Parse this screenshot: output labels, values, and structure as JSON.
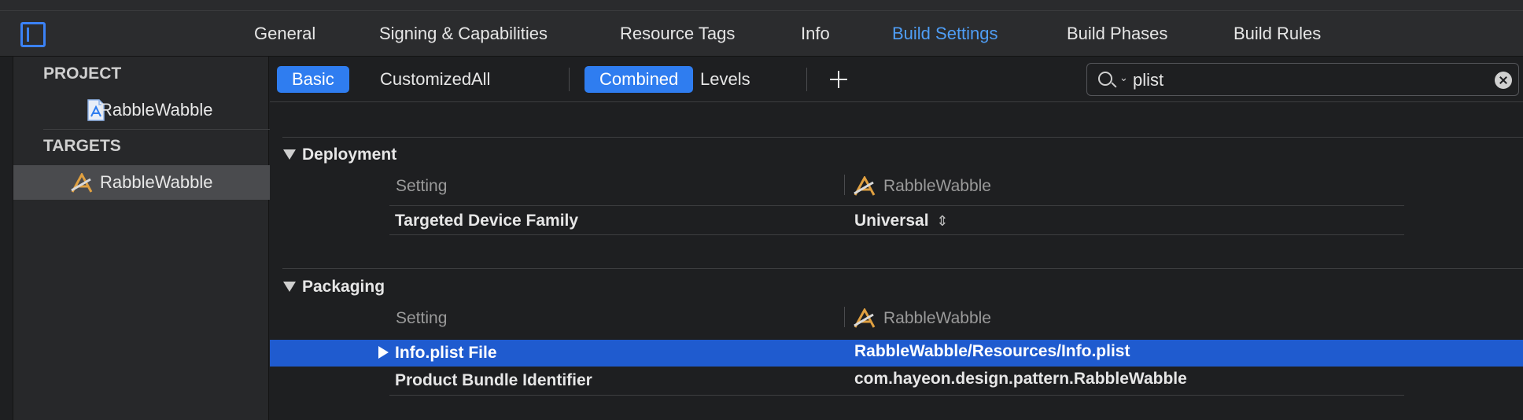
{
  "tabs": [
    "General",
    "Signing & Capabilities",
    "Resource Tags",
    "Info",
    "Build Settings",
    "Build Phases",
    "Build Rules"
  ],
  "active_tab": "Build Settings",
  "sidebar": {
    "project_header": "PROJECT",
    "project_item": "RabbleWabble",
    "targets_header": "TARGETS",
    "target_item": "RabbleWabble"
  },
  "filters": {
    "basic": "Basic",
    "customized": "Customized",
    "all": "All",
    "combined": "Combined",
    "levels": "Levels"
  },
  "search": {
    "value": "plist"
  },
  "sections": {
    "deployment": {
      "title": "Deployment",
      "col_setting": "Setting",
      "col_target": "RabbleWabble",
      "rows": [
        {
          "name": "Targeted Device Family",
          "value": "Universal"
        }
      ]
    },
    "packaging": {
      "title": "Packaging",
      "col_setting": "Setting",
      "col_target": "RabbleWabble",
      "rows": [
        {
          "name": "Info.plist File",
          "value": "RabbleWabble/Resources/Info.plist"
        },
        {
          "name": "Product Bundle Identifier",
          "value": "com.hayeon.design.pattern.RabbleWabble"
        }
      ]
    }
  },
  "colors": {
    "accent": "#2f7df0",
    "active_tab": "#4f9ef6",
    "selection": "#1f5bcf",
    "background": "#1e1f21"
  }
}
